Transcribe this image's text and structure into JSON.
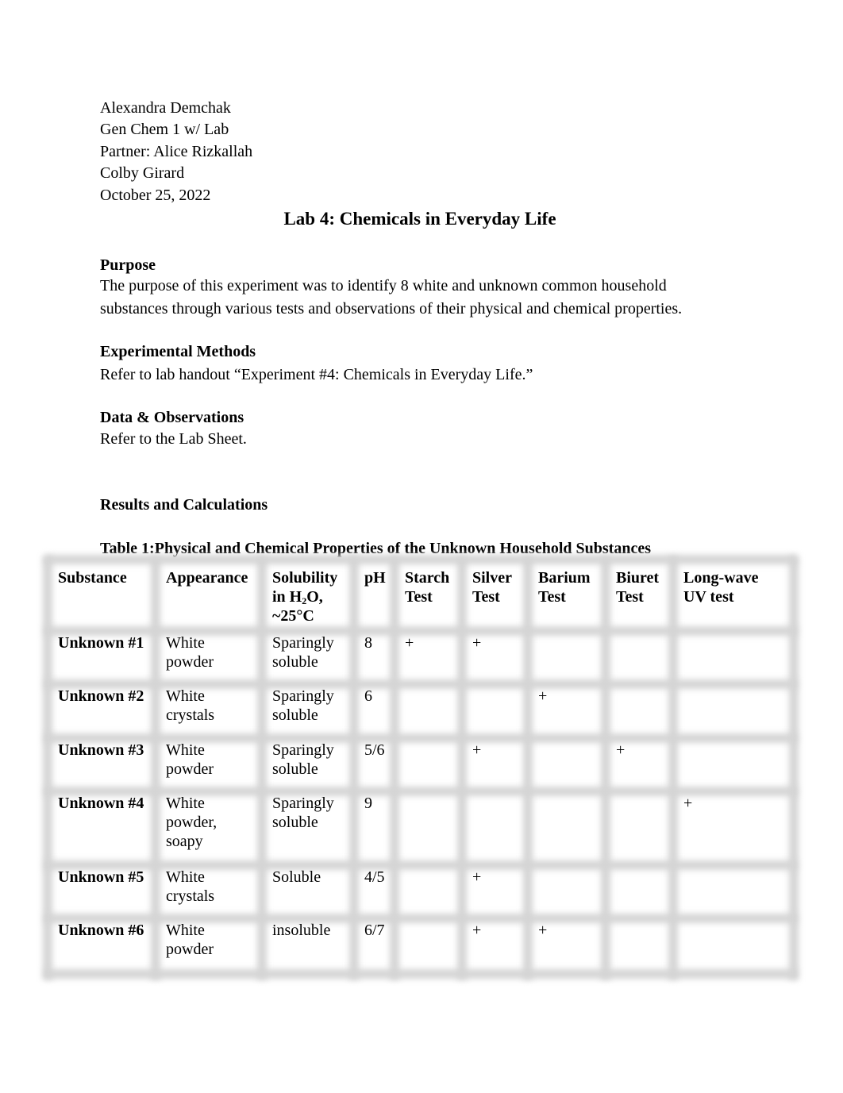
{
  "header": {
    "author": "Alexandra Demchak",
    "course": "Gen Chem 1 w/ Lab",
    "partner": "Partner: Alice Rizkallah",
    "instructor": "Colby Girard",
    "date": "October 25, 2022"
  },
  "title": "Lab 4: Chemicals in Everyday Life",
  "sections": {
    "purpose": {
      "heading": "Purpose",
      "line1": "The purpose of this experiment was to identify 8 white and unknown common household",
      "line2": "substances through various tests and observations of their physical and chemical properties."
    },
    "methods": {
      "heading": "Experimental Methods",
      "body": "Refer to lab handout “Experiment #4: Chemicals in Everyday Life.”"
    },
    "data": {
      "heading": "Data & Observations",
      "body": "Refer to the Lab Sheet."
    },
    "results": {
      "heading": "Results and Calculations"
    }
  },
  "table": {
    "caption": "Table 1:Physical and Chemical Properties of the Unknown Household Substances",
    "columns": [
      {
        "label": "Substance"
      },
      {
        "label": "Appearance"
      },
      {
        "label_pre": "Solubility\nin H",
        "label_sub": "2",
        "label_post": "O,\n~25°C"
      },
      {
        "label": "pH"
      },
      {
        "label": "Starch\nTest"
      },
      {
        "label": "Silver\nTest"
      },
      {
        "label": "Barium\nTest"
      },
      {
        "label": "Biuret\nTest"
      },
      {
        "label": "Long-wave\nUV test"
      }
    ],
    "rows": [
      {
        "substance": "Unknown #1",
        "appearance": "White\npowder",
        "solubility": "Sparingly\nsoluble",
        "ph": "8",
        "starch": "+",
        "silver": "+",
        "barium": "",
        "biuret": "",
        "uv": ""
      },
      {
        "substance": "Unknown #2",
        "appearance": "White\ncrystals",
        "solubility": "Sparingly\nsoluble",
        "ph": "6",
        "starch": "",
        "silver": "",
        "barium": "+",
        "biuret": "",
        "uv": ""
      },
      {
        "substance": "Unknown #3",
        "appearance": "White\npowder",
        "solubility": "Sparingly\nsoluble",
        "ph": "5/6",
        "starch": "",
        "silver": "+",
        "barium": "",
        "biuret": "+",
        "uv": ""
      },
      {
        "substance": "Unknown #4",
        "appearance": "White\npowder,\nsoapy",
        "solubility": "Sparingly\nsoluble",
        "ph": "9",
        "starch": "",
        "silver": "",
        "barium": "",
        "biuret": "",
        "uv": "+"
      },
      {
        "substance": "Unknown #5",
        "appearance": "White\ncrystals",
        "solubility": "Soluble",
        "ph": "4/5",
        "starch": "",
        "silver": "+",
        "barium": "",
        "biuret": "",
        "uv": ""
      },
      {
        "substance": "Unknown #6",
        "appearance": "White\npowder",
        "solubility": "insoluble",
        "ph": "6/7",
        "starch": "",
        "silver": "+",
        "barium": "+",
        "biuret": "",
        "uv": ""
      }
    ]
  }
}
